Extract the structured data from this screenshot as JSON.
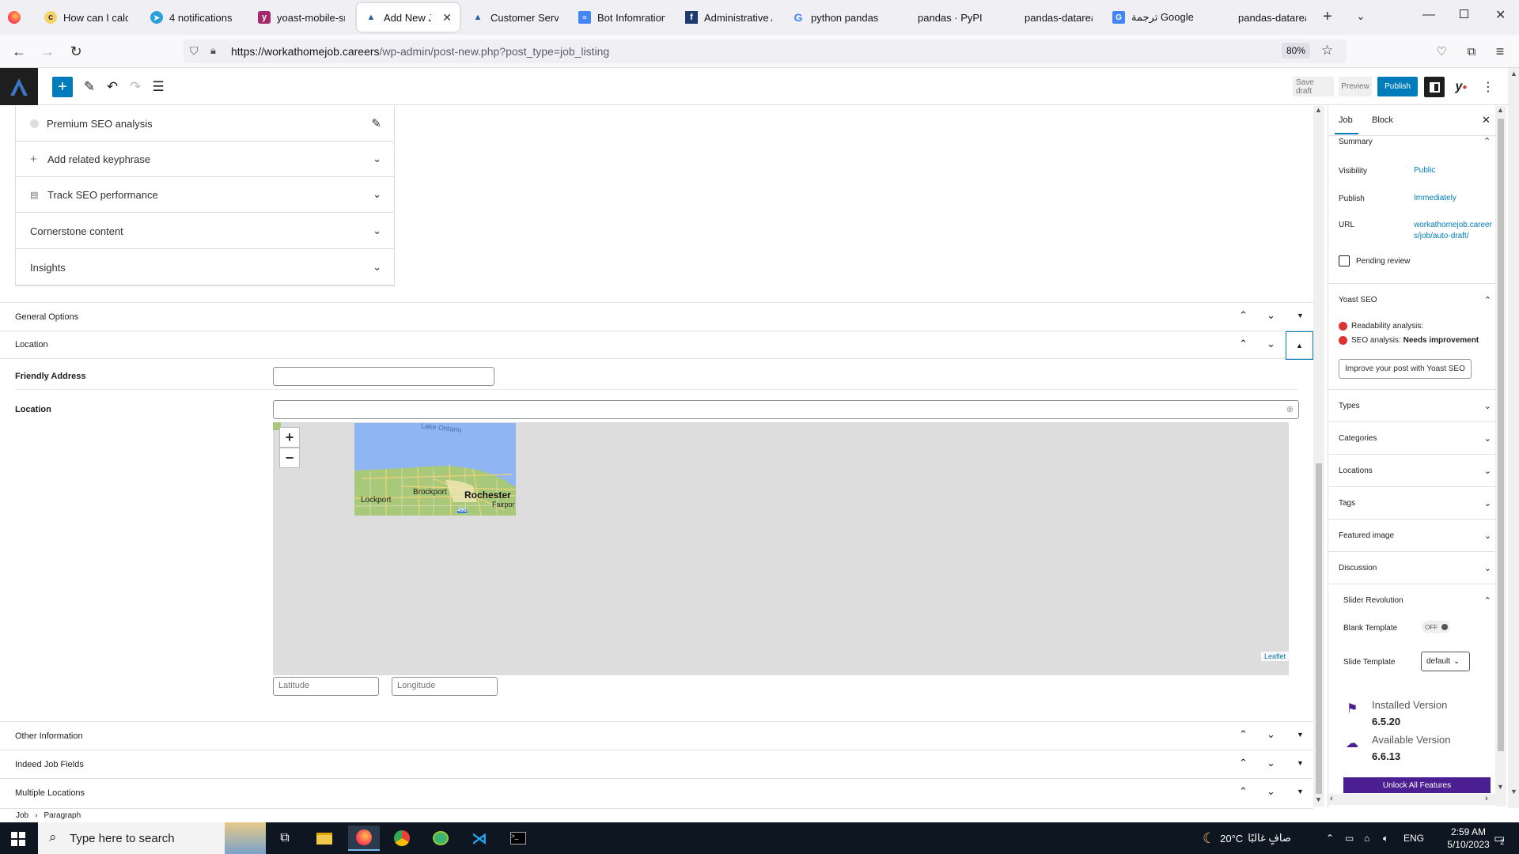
{
  "browser": {
    "tabs": [
      {
        "title": "How can I calcula",
        "icon": "tab-favicon"
      },
      {
        "title": "4 notifications",
        "icon": "telegram-icon"
      },
      {
        "title": "yoast-mobile-sni",
        "icon": "yoast-icon"
      },
      {
        "title": "Add New Job",
        "icon": "site-icon",
        "active": true
      },
      {
        "title": "Customer Service",
        "icon": "site-icon"
      },
      {
        "title": "Bot Infomration",
        "icon": "docs-icon"
      },
      {
        "title": "Administrative A",
        "icon": "facebook-icon"
      },
      {
        "title": "python pandas -",
        "icon": "google-icon"
      },
      {
        "title": "pandas · PyPI",
        "icon": "blank-icon"
      },
      {
        "title": "pandas-datareade",
        "icon": "blank-icon"
      },
      {
        "title": "ترجمة Google",
        "icon": "translate-icon"
      },
      {
        "title": "pandas-datareade",
        "icon": "blank-icon"
      }
    ],
    "url_domain": "https://workathomejob.careers",
    "url_path": "/wp-admin/post-new.php?post_type=job_listing",
    "zoom": "80%"
  },
  "toolbar": {
    "save_draft": "Save draft",
    "preview": "Preview",
    "publish": "Publish"
  },
  "yoast_panel": {
    "premium_seo": "Premium SEO analysis",
    "related_keyphrase": "Add related keyphrase",
    "track_seo": "Track SEO performance",
    "cornerstone": "Cornerstone content",
    "insights": "Insights"
  },
  "metaboxes": {
    "general_options": "General Options",
    "location": "Location",
    "other_information": "Other Information",
    "indeed_job_fields": "Indeed Job Fields",
    "multiple_locations": "Multiple Locations"
  },
  "location_fields": {
    "friendly_address_label": "Friendly Address",
    "location_label": "Location",
    "latitude_placeholder": "Latitude",
    "longitude_placeholder": "Longitude",
    "map_attribution": "Leaflet",
    "map_labels": {
      "lake": "Lake Ontario",
      "city1": "Lockport",
      "city2": "Brockport",
      "city3": "Rochester",
      "city4": "Fairpor",
      "highway": "490"
    }
  },
  "breadcrumb": {
    "item1": "Job",
    "item2": "Paragraph"
  },
  "sidebar": {
    "tab_job": "Job",
    "tab_block": "Block",
    "summary": "Summary",
    "visibility_label": "Visibility",
    "visibility_value": "Public",
    "publish_label": "Publish",
    "publish_value": "Immediately",
    "url_label": "URL",
    "url_value_1": "workathomejob.career",
    "url_value_2": "s/job/auto-draft/",
    "pending_review": "Pending review",
    "yoast_seo": "Yoast SEO",
    "readability": "Readability analysis:",
    "seo_analysis_label": "SEO analysis:",
    "seo_analysis_value": "Needs improvement",
    "improve_button": "Improve your post with Yoast SEO",
    "types": "Types",
    "categories": "Categories",
    "locations": "Locations",
    "tags": "Tags",
    "featured_image": "Featured image",
    "discussion": "Discussion",
    "slider_revolution": "Slider Revolution",
    "blank_template": "Blank Template",
    "blank_template_toggle": "OFF",
    "slide_template": "Slide Template",
    "slide_template_value": "default",
    "installed_version_label": "Installed Version",
    "installed_version": "6.5.20",
    "available_version_label": "Available Version",
    "available_version": "6.6.13",
    "unlock_button": "Unlock All Features"
  },
  "taskbar": {
    "search_placeholder": "Type here to search",
    "weather": "20°C",
    "weather_desc": "صافٍ غالبًا",
    "language": "ENG",
    "time": "2:59 AM",
    "date": "5/10/2023",
    "notification_count": "2"
  },
  "colors": {
    "wp_blue": "#007cba",
    "yoast_red": "#dc3232",
    "slider_purple": "#4b1e91"
  }
}
